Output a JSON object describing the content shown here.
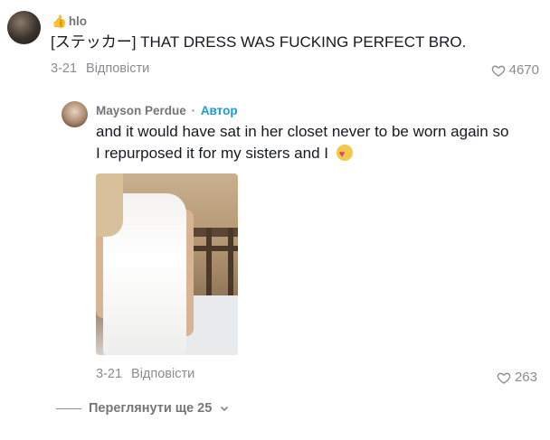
{
  "comments": [
    {
      "username": "hlo",
      "username_prefix": "👍",
      "text": "[ステッカー] THAT DRESS WAS FUCKING PERFECT BRO.",
      "date": "3-21",
      "reply_label": "Відповісти",
      "likes": "4670"
    }
  ],
  "reply": {
    "username": "Mayson Perdue",
    "separator": "·",
    "author_badge": "Автор",
    "text": "and it would have sat in her closet never to be worn again so I repurposed it for my sisters and I",
    "emoji_name": "smiling-face-with-hearts",
    "date": "3-21",
    "reply_label": "Відповісти",
    "likes": "263",
    "image_name": "white-strapless-dress-photo"
  },
  "view_more": {
    "label": "Переглянути ще 25"
  },
  "colors": {
    "author_badge": "#1b9bd8",
    "muted": "#8a8b91",
    "text": "#161823"
  }
}
